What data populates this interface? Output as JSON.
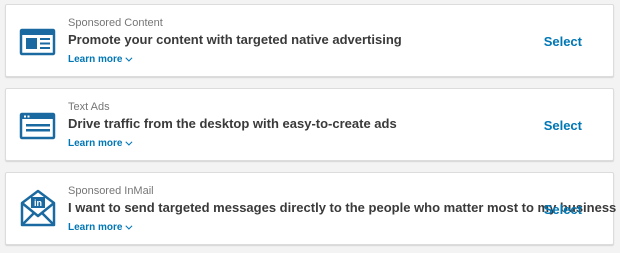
{
  "colors": {
    "accent": "#0077b5",
    "icon": "#1a6aa1",
    "headline": "#3a3a3a",
    "category": "#767676",
    "background": "#f3f3f3"
  },
  "options": [
    {
      "icon": "sponsored-content-icon",
      "category": "Sponsored Content",
      "headline": "Promote your content with targeted native advertising",
      "learn_more": "Learn more",
      "select": "Select"
    },
    {
      "icon": "text-ads-icon",
      "category": "Text Ads",
      "headline": "Drive traffic from the desktop with easy-to-create ads",
      "learn_more": "Learn more",
      "select": "Select"
    },
    {
      "icon": "sponsored-inmail-icon",
      "category": "Sponsored InMail",
      "headline": "I want to send targeted messages directly to the people who matter most to my business",
      "learn_more": "Learn more",
      "select": "Select",
      "icon_text": "in"
    }
  ]
}
